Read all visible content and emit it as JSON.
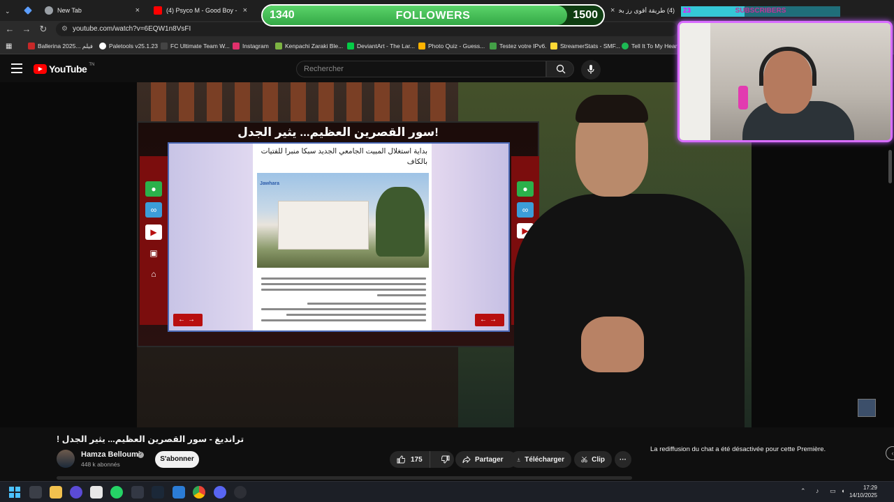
{
  "browser": {
    "tabs": [
      {
        "label": "",
        "color": "#5c9eff"
      },
      {
        "label": "New Tab",
        "color": "#9aa0a6"
      },
      {
        "label": "(4) Psyco M - Good Boy - You",
        "color": "#ff0000"
      },
      {
        "label": "(4) طريقة أقوى رز بخاري في",
        "color": "#ff0000"
      }
    ],
    "url": "youtube.com/watch?v=6EQW1n8VsFI",
    "bookmarks": [
      {
        "label": "Ballerina 2025... فيلم",
        "color": "#c62828"
      },
      {
        "label": "Paletools v25.1.23",
        "color": "#ffffff"
      },
      {
        "label": "FC Ultimate Team W...",
        "color": "#222222"
      },
      {
        "label": "Instagram",
        "color": "#e1306c"
      },
      {
        "label": "Kenpachi Zaraki Ble...",
        "color": "#7cb342"
      },
      {
        "label": "DeviantArt - The Lar...",
        "color": "#05cc47"
      },
      {
        "label": "Photo Quiz - Guess...",
        "color": "#ffb300"
      },
      {
        "label": "Testez votre IPv6.",
        "color": "#43a047"
      },
      {
        "label": "StreamerStats - SMF...",
        "color": "#fdd835"
      },
      {
        "label": "Tell It To My Heart",
        "color": "#1db954"
      }
    ]
  },
  "youtube": {
    "logo_text": "YouTube",
    "logo_sup": "TN",
    "search_placeholder": "Rechercher"
  },
  "overlay": {
    "followers": {
      "current": "1340",
      "label": "FOLLOWERS",
      "goal": "1500",
      "progress": 0.893
    },
    "subscribers": {
      "current": "23",
      "label": "SUBSCRIBERS",
      "progress": 0.4
    }
  },
  "video_content": {
    "tv_title": "سور القصرين العظيم... يثير الجدل!",
    "article_headline": "بداية استغلال المبيت الجامعي الجديد سبكا منبرا للفتيات بالكاف",
    "photo_tag": "Jawhara"
  },
  "video": {
    "title": "ترانديغ - سور القصرين العظيم... يثير الجدل !",
    "channel_name": "Hamza Belloumi",
    "subscribers": "448 k abonnés",
    "subscribe_label": "S'abonner",
    "likes": "175",
    "share_label": "Partager",
    "download_label": "Télécharger",
    "clip_label": "Clip",
    "more_label": "···"
  },
  "chat": {
    "disabled_message": "La rediffusion du chat a été désactivée pour cette Première."
  },
  "taskbar": {
    "time": "17:29",
    "date": "14/10/2025"
  }
}
